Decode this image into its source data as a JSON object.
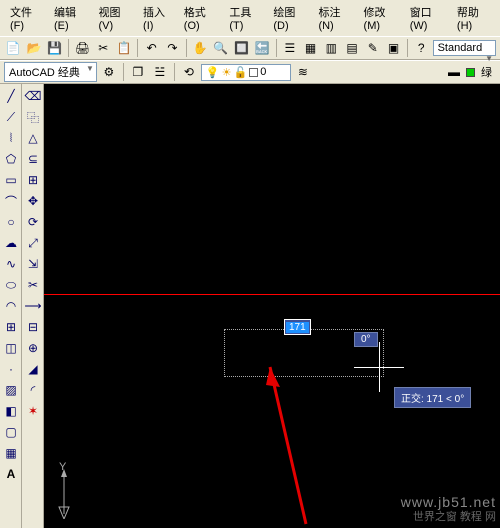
{
  "menu": {
    "file": "文件(F)",
    "edit": "编辑(E)",
    "view": "视图(V)",
    "insert": "插入(I)",
    "format": "格式(O)",
    "tools": "工具(T)",
    "draw": "绘图(D)",
    "annotate": "标注(N)",
    "modify": "修改(M)",
    "window": "窗口(W)",
    "help": "帮助(H)"
  },
  "workspace": {
    "label": "AutoCAD 经典"
  },
  "layer": {
    "current": "0"
  },
  "style": {
    "current": "Standard"
  },
  "color": {
    "swatch": "绿"
  },
  "canvas": {
    "input_length": "171",
    "input_angle": "0°",
    "tooltip": "正交: 171 < 0°",
    "ucs_y": "Y"
  },
  "watermark": {
    "line1": "www.jb51.net",
    "line2": "世界之窗 教程 网"
  }
}
